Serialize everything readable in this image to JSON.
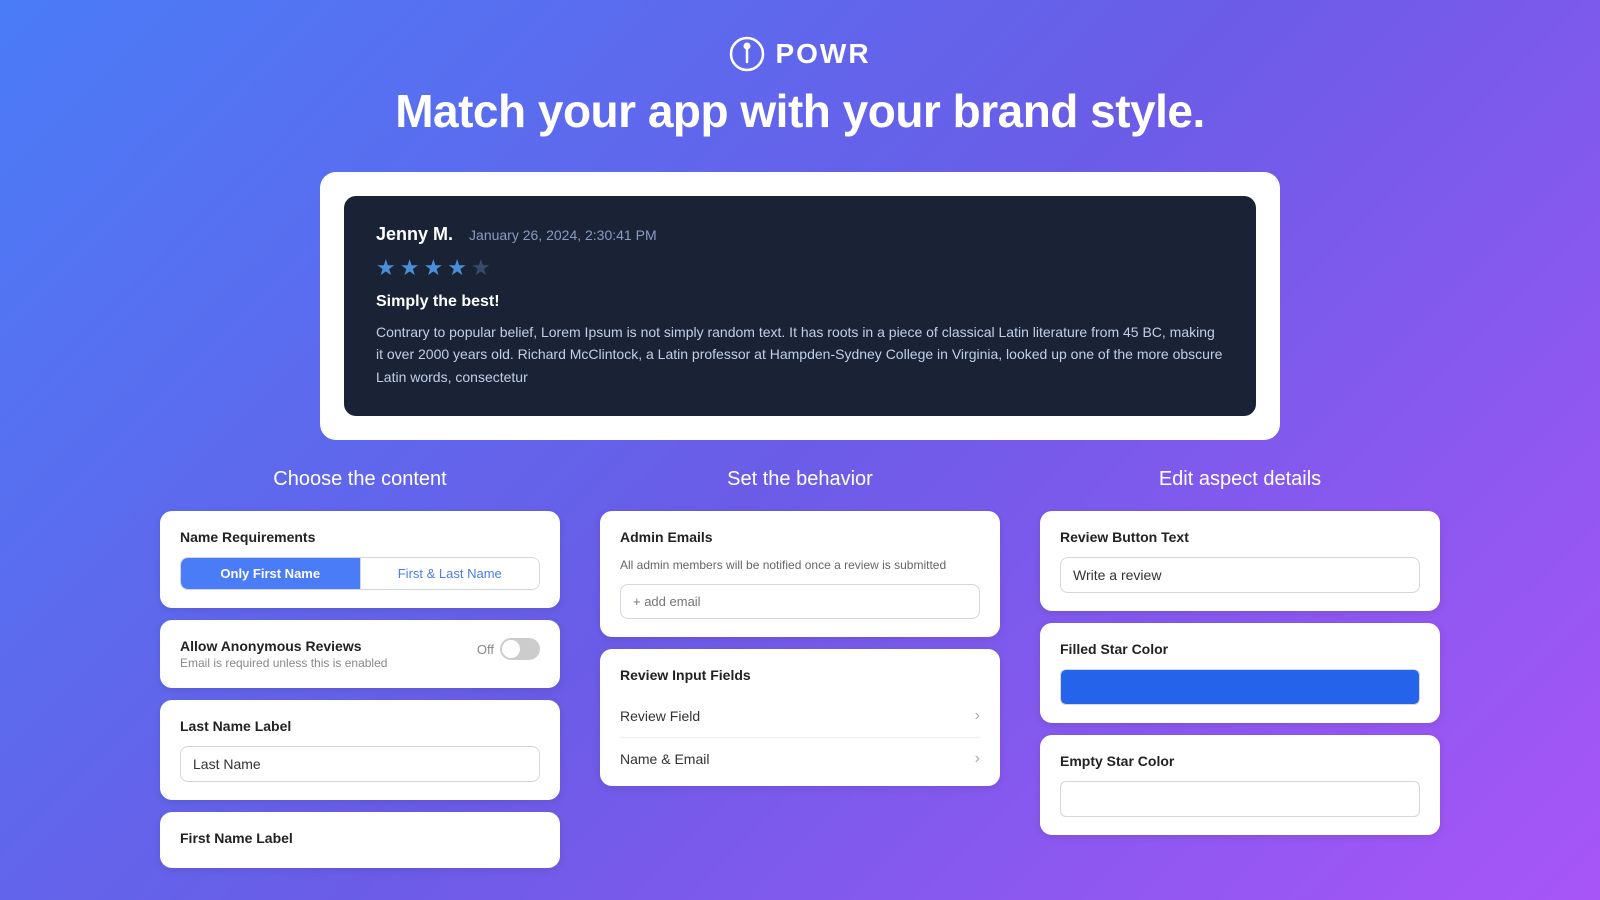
{
  "header": {
    "logo_text": "POWR",
    "headline": "Match your app with your brand style."
  },
  "review_preview": {
    "reviewer": "Jenny M.",
    "date": "January 26, 2024, 2:30:41 PM",
    "stars": 4,
    "title": "Simply the best!",
    "body": "Contrary to popular belief, Lorem Ipsum is not simply random text. It has roots in a piece of classical Latin literature from 45 BC, making it over 2000 years old. Richard McClintock, a Latin professor at Hampden-Sydney College in Virginia, looked up one of the more obscure Latin words, consectetur"
  },
  "content_section": {
    "title": "Choose the content",
    "name_requirements": {
      "card_title": "Name Requirements",
      "option1": "Only First Name",
      "option2": "First & Last Name",
      "active": "option1"
    },
    "anonymous_reviews": {
      "card_title": "Allow Anonymous Reviews",
      "sublabel": "Email is required unless this is enabled",
      "state": "Off"
    },
    "last_name_label": {
      "card_title": "Last Name Label",
      "placeholder": "Last Name"
    },
    "first_name_label": {
      "card_title": "First Name Label"
    }
  },
  "behavior_section": {
    "title": "Set the behavior",
    "admin_emails": {
      "card_title": "Admin Emails",
      "description": "All admin members will be notified once a review is submitted",
      "placeholder": "+ add email"
    },
    "review_input_fields": {
      "card_title": "Review Input Fields",
      "items": [
        {
          "label": "Review Field"
        },
        {
          "label": "Name & Email"
        }
      ]
    }
  },
  "aspect_section": {
    "title": "Edit aspect details",
    "review_button_text": {
      "card_title": "Review Button Text",
      "value": "Write a review"
    },
    "filled_star_color": {
      "card_title": "Filled Star Color",
      "color": "blue"
    },
    "empty_star_color": {
      "card_title": "Empty Star Color",
      "color": "white"
    }
  }
}
